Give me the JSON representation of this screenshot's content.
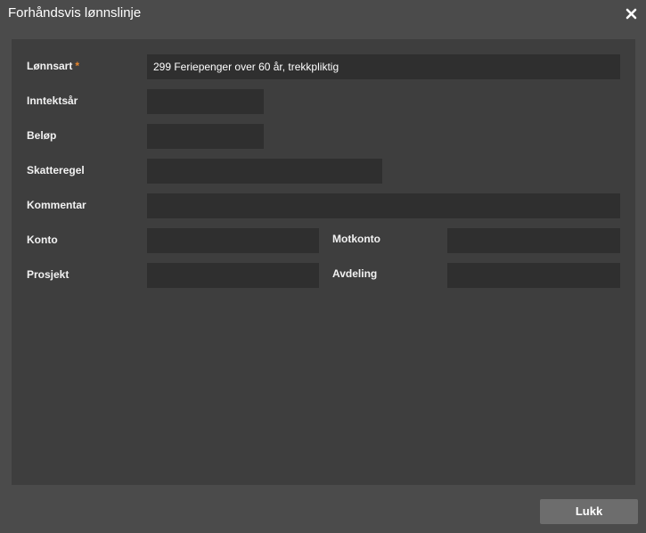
{
  "dialog": {
    "title": "Forhåndsvis lønnslinje",
    "close_icon": "close-icon"
  },
  "form": {
    "lonnsart": {
      "label": "Lønnsart",
      "required_marker": "*",
      "value": "299 Feriepenger over 60 år, trekkpliktig"
    },
    "inntektsar": {
      "label": "Inntektsår",
      "value": ""
    },
    "belop": {
      "label": "Beløp",
      "value": ""
    },
    "skatteregel": {
      "label": "Skatteregel",
      "value": ""
    },
    "kommentar": {
      "label": "Kommentar",
      "value": ""
    },
    "konto": {
      "label": "Konto",
      "value": ""
    },
    "motkonto": {
      "label": "Motkonto",
      "value": ""
    },
    "prosjekt": {
      "label": "Prosjekt",
      "value": ""
    },
    "avdeling": {
      "label": "Avdeling",
      "value": ""
    }
  },
  "footer": {
    "close_label": "Lukk"
  },
  "colors": {
    "dialog_bg": "#4b4b4b",
    "panel_bg": "#3e3e3e",
    "field_bg": "#2f2f2f",
    "required": "#e8862c",
    "button_bg": "#6d6d6d"
  }
}
